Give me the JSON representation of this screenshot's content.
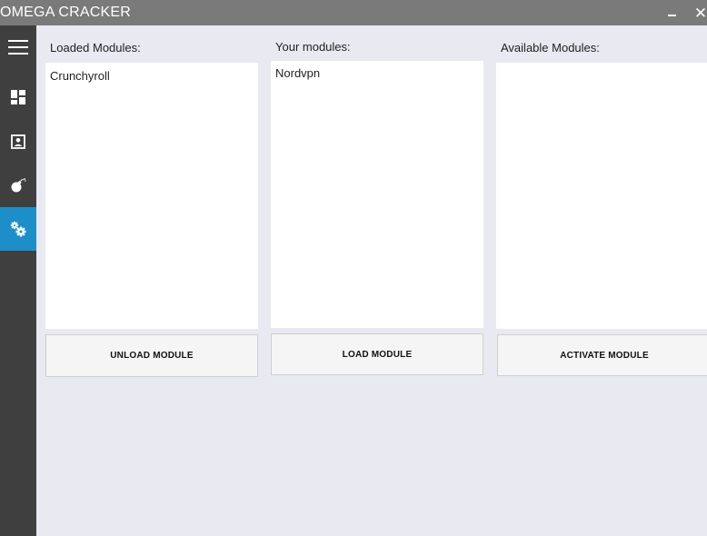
{
  "window": {
    "title": "OMEGA CRACKER",
    "minimize_glyph": "",
    "close_glyph": "✕"
  },
  "sidebar": {
    "items": [
      {
        "icon": "hamburger-menu-icon"
      },
      {
        "icon": "dashboard-icon"
      },
      {
        "icon": "account-box-icon"
      },
      {
        "icon": "bomb-icon"
      },
      {
        "icon": "settings-gears-icon",
        "active": true
      }
    ],
    "active_color": "#1e8ec9",
    "background_color": "#3f3f3f"
  },
  "panels": {
    "loaded": {
      "label": "Loaded Modules:",
      "items": [
        "Crunchyroll"
      ],
      "button": "UNLOAD MODULE"
    },
    "yours": {
      "label": "Your modules:",
      "items": [
        "Nordvpn"
      ],
      "button": "LOAD MODULE"
    },
    "available": {
      "label": "Available Modules:",
      "items": [],
      "button": "ACTIVATE MODULE"
    }
  }
}
